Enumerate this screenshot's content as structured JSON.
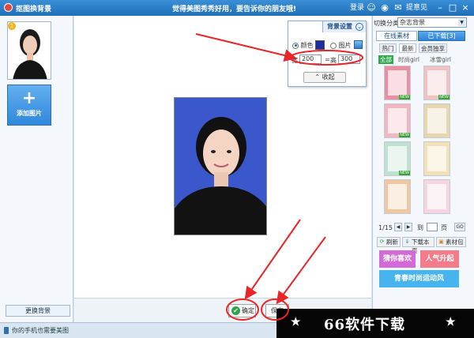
{
  "window": {
    "title": "抠图换背景",
    "slogan": "觉得美图秀秀好用，要告诉你的朋友哦!",
    "login": "登录",
    "feedback": "提意见"
  },
  "left_panel": {
    "add_image": "添加图片",
    "change_background": "更换背景",
    "thumb_badge": "1"
  },
  "canvas": {
    "ok_button": "确定",
    "save_button": "保存"
  },
  "settings": {
    "tab_label": "背景设置",
    "color_label": "颜色",
    "color_value": "#1b2c9c",
    "picture_label": "图片",
    "mode": "color",
    "width_label": "宽",
    "width_value": "200",
    "separator": "=",
    "height_label": "高",
    "height_value": "300",
    "collapse_button": "收起"
  },
  "right_panel": {
    "category_label": "切换分类",
    "category_value": "杂志背景",
    "source_tabs": [
      "在线素材",
      "已下载[3]"
    ],
    "sub_tabs": [
      "热门",
      "最新",
      "会员独享"
    ],
    "filters": [
      "全部",
      "时尚girl",
      "冰雪girl"
    ],
    "templates": [
      {
        "color": "#e98fa4",
        "new": "NEW"
      },
      {
        "color": "#f0c2c2",
        "new": "NEW"
      },
      {
        "color": "#f2b6c0",
        "new": "NEW"
      },
      {
        "color": "#e8d6ae",
        "new": ""
      },
      {
        "color": "#bfe2d0",
        "new": "NEW"
      },
      {
        "color": "#f3e0b6",
        "new": ""
      },
      {
        "color": "#f0c7a0",
        "new": ""
      },
      {
        "color": "#f6d5e0",
        "new": ""
      }
    ],
    "pager": {
      "current": "1/15",
      "to_label": "到",
      "page_label": "页",
      "go": "GO"
    },
    "actions": [
      "刷新",
      "下载本页",
      "素材包"
    ],
    "ads": [
      {
        "text": "猜你喜欢",
        "color": "#d46ad8"
      },
      {
        "text": "人气升起",
        "color": "#f47c8a"
      },
      {
        "text": "青春时尚运动风",
        "color": "#47b4f0"
      }
    ]
  },
  "statusbar": {
    "text": "你的手机也需要美图"
  },
  "watermark": {
    "star": "★",
    "text": "66软件下载"
  }
}
